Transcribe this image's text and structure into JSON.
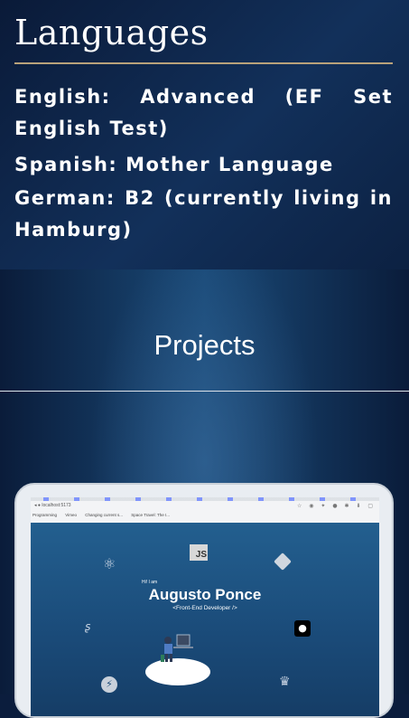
{
  "languages": {
    "title": "Languages",
    "items": [
      "English: Advanced (EF Set English Test)",
      "Spanish: Mother Language",
      "German: B2 (currently living in Hamburg)"
    ]
  },
  "projects": {
    "title": "Projects"
  },
  "preview": {
    "browser_url": "localhost:5173",
    "bookmarks": [
      "Programming",
      "Vimeo",
      "Changing current s...",
      "Space Travel: The I..."
    ],
    "greeting": "Hi! I am",
    "name": "Augusto Ponce",
    "role": "<Front-End Developer />",
    "icons": [
      "js-icon",
      "react-icon",
      "git-icon",
      "sass-icon",
      "github-icon",
      "redux-icon",
      "crown-icon"
    ]
  },
  "colors": {
    "accent_rule": "#b9a27a",
    "background_dark": "#0a1a38",
    "text": "#ffffff"
  }
}
